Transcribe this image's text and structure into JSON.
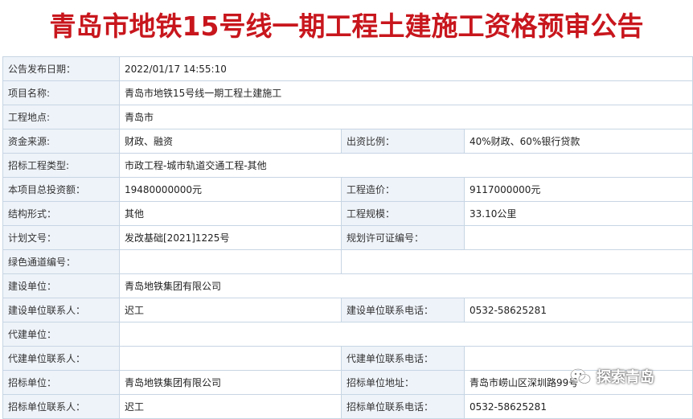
{
  "title": "青岛市地铁15号线一期工程土建施工资格预审公告",
  "rows": [
    {
      "l1": "公告发布日期：",
      "v1": "2022/01/17 14:55:10"
    },
    {
      "l1": "项目名称:",
      "v1": "青岛市地铁15号线一期工程土建施工"
    },
    {
      "l1": "工程地点:",
      "v1": "青岛市"
    },
    {
      "l1": "资金来源:",
      "v1": "财政、融资",
      "l2": "出资比例：",
      "v2": "40%财政、60%银行贷款"
    },
    {
      "l1": "招标工程类型:",
      "v1": "市政工程-城市轨道交通工程-其他"
    },
    {
      "l1": "本项目总投资额：",
      "v1": "19480000000元",
      "l2": "工程造价：",
      "v2": "9117000000元"
    },
    {
      "l1": "结构形式：",
      "v1": "其他",
      "l2": "工程规模：",
      "v2": "33.10公里"
    },
    {
      "l1": "计划文号：",
      "v1": "发改基础[2021]1225号",
      "l2": "规划许可证编号：",
      "v2": ""
    },
    {
      "l1": "绿色通道编号：",
      "v1": "",
      "l2": "",
      "v2": ""
    },
    {
      "l1": "建设单位：",
      "v1": "青岛地铁集团有限公司"
    },
    {
      "l1": "建设单位联系人：",
      "v1": "迟工",
      "l2": "建设单位联系电话：",
      "v2": "0532-58625281"
    },
    {
      "l1": "代建单位：",
      "v1": ""
    },
    {
      "l1": "代建单位联系人：",
      "v1": "",
      "l2": "代建单位联系电话：",
      "v2": ""
    },
    {
      "l1": "招标单位：",
      "v1": "青岛地铁集团有限公司",
      "l2": "招标单位地址：",
      "v2": "青岛市崂山区深圳路99号"
    },
    {
      "l1": "招标单位联系人：",
      "v1": "迟工",
      "l2": "招标单位联系电话：",
      "v2": "0532-58625281"
    }
  ],
  "watermark": {
    "text": "探索青岛",
    "icon": "wechat-icon"
  }
}
